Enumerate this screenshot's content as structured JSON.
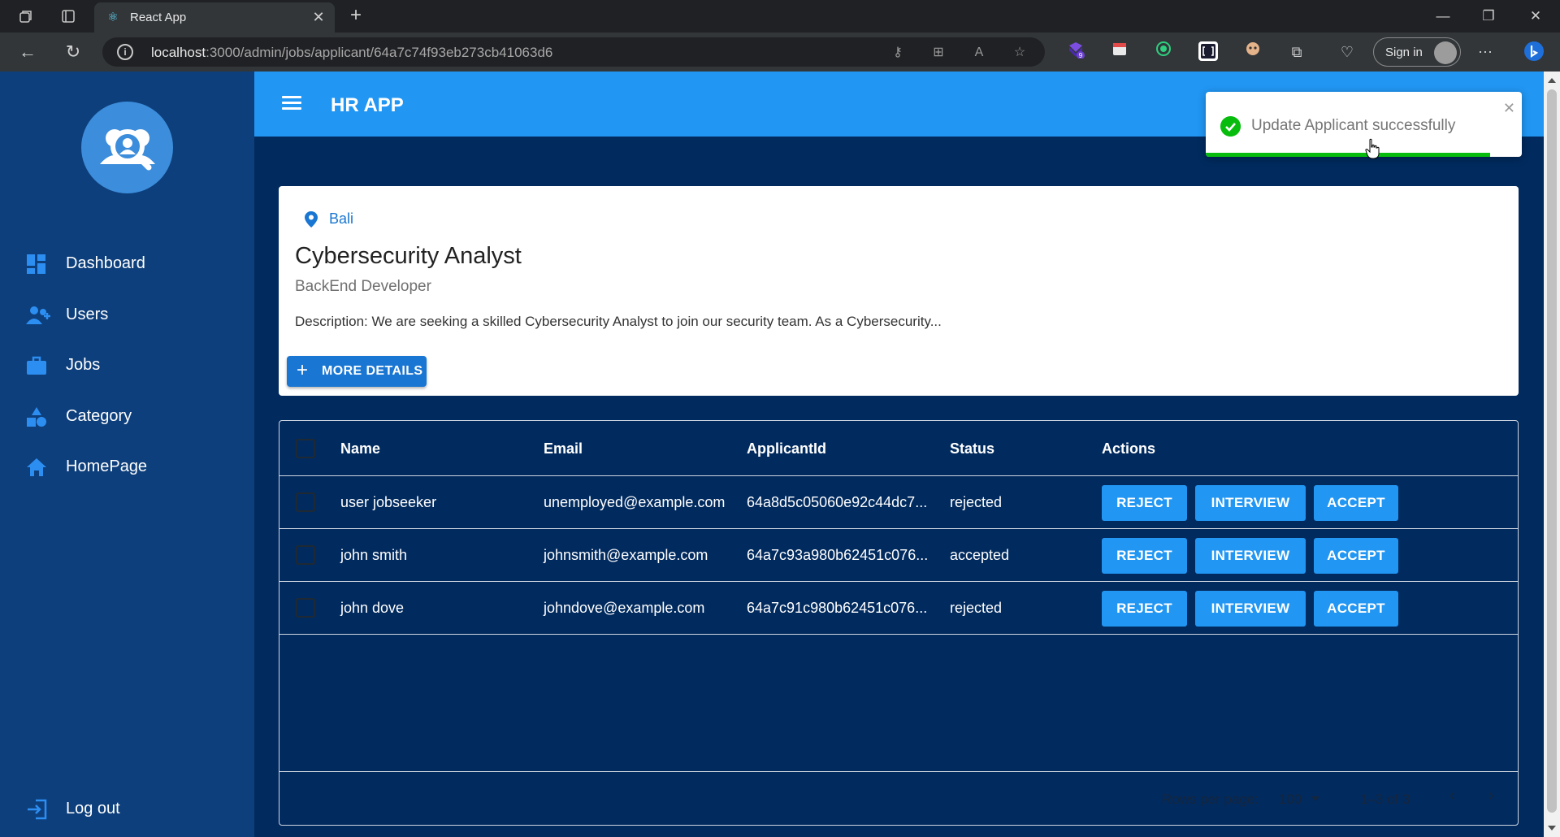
{
  "browser": {
    "tab_title": "React App",
    "url_host": "localhost",
    "url_rest": ":3000/admin/jobs/applicant/64a7c74f93eb273cb41063d6",
    "signin_label": "Sign in",
    "ext_badge": "9"
  },
  "app": {
    "title": "HR APP"
  },
  "sidebar": {
    "items": [
      {
        "label": "Dashboard",
        "icon": "dashboard-icon"
      },
      {
        "label": "Users",
        "icon": "users-icon"
      },
      {
        "label": "Jobs",
        "icon": "briefcase-icon"
      },
      {
        "label": "Category",
        "icon": "category-icon"
      },
      {
        "label": "HomePage",
        "icon": "home-icon"
      }
    ],
    "logout_label": "Log out"
  },
  "job": {
    "location": "Bali",
    "title": "Cybersecurity Analyst",
    "category": "BackEnd Developer",
    "description": "Description: We are seeking a skilled Cybersecurity Analyst to join our security team. As a Cybersecurity...",
    "more_details_label": "MORE DETAILS"
  },
  "grid": {
    "columns": [
      "Name",
      "Email",
      "ApplicantId",
      "Status",
      "Actions"
    ],
    "rows": [
      {
        "name": "user jobseeker",
        "email": "unemployed@example.com",
        "applicant_id": "64a8d5c05060e92c44dc7...",
        "status": "rejected"
      },
      {
        "name": "john smith",
        "email": "johnsmith@example.com",
        "applicant_id": "64a7c93a980b62451c076...",
        "status": "accepted"
      },
      {
        "name": "john dove",
        "email": "johndove@example.com",
        "applicant_id": "64a7c91c980b62451c076...",
        "status": "rejected"
      }
    ],
    "actions": {
      "reject": "REJECT",
      "interview": "INTERVIEW",
      "accept": "ACCEPT"
    },
    "footer": {
      "rows_per_page_label": "Rows per page:",
      "rows_per_page_value": "100",
      "range": "1–3 of 3"
    }
  },
  "toast": {
    "message": "Update Applicant successfully",
    "progress_fraction": 0.9
  },
  "colors": {
    "accent": "#2196f3",
    "sidebar": "#0d3f7c",
    "background": "#012a5e",
    "success": "#07bc0c"
  }
}
